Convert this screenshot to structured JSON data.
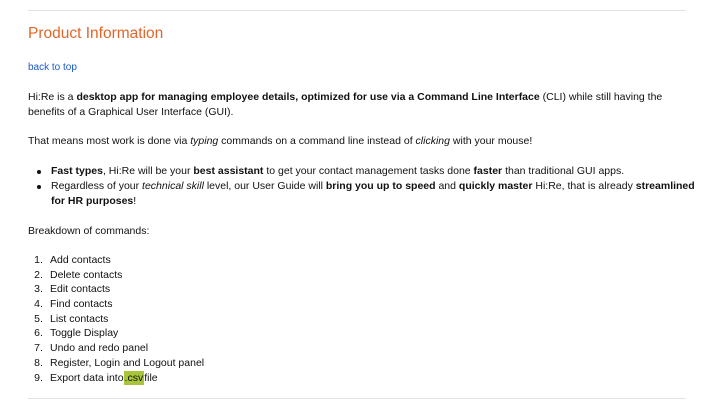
{
  "section": {
    "title": "Product Information",
    "back_link": "back to top"
  },
  "intro": {
    "p1": "Hi:Re is a ",
    "p1_bold": "desktop app for managing employee details, optimized for use via a Command Line Interface",
    "p1_rest": " (CLI) while still having the benefits of a Graphical User Interface (GUI).",
    "p2_a": "That means most work is done via ",
    "p2_i1": "typing",
    "p2_b": " commands on a command line instead of ",
    "p2_i2": "clicking",
    "p2_c": " with your mouse!"
  },
  "bullets": {
    "b1_bold1": "Fast types",
    "b1_a": ", Hi:Re will be your ",
    "b1_bold2": "best assistant",
    "b1_b": " to get your contact management tasks done ",
    "b1_bold3": "faster",
    "b1_c": " than traditional GUI apps.",
    "b2_a": "Regardless of your ",
    "b2_i": "technical skill",
    "b2_b": " level, our User Guide will ",
    "b2_bold1": "bring you up to speed",
    "b2_c": " and ",
    "b2_bold2": "quickly master",
    "b2_d": " Hi:Re, that is already ",
    "b2_bold3": "streamlined for HR purposes",
    "b2_e": "!"
  },
  "breakdown_label": "Breakdown of commands:",
  "commands": [
    {
      "num": "1",
      "label": "Add contacts"
    },
    {
      "num": "2",
      "label": "Delete contacts"
    },
    {
      "num": "3",
      "label": "Edit contacts"
    },
    {
      "num": "4",
      "label": "Find contacts"
    },
    {
      "num": "5",
      "label": "List contacts"
    },
    {
      "num": "6",
      "label": "Toggle Display"
    },
    {
      "num": "7",
      "label": "Undo and redo panel"
    },
    {
      "num": "8",
      "label": "Register, Login and Logout panel"
    },
    {
      "num": "9",
      "label": "Export data into ",
      "code": ".csv",
      "suffix": " file"
    }
  ],
  "colors": {
    "title": "#e0662a",
    "link": "#1a59c9",
    "code_highlight": "#a8c53a",
    "rule": "#e3e3e3"
  }
}
